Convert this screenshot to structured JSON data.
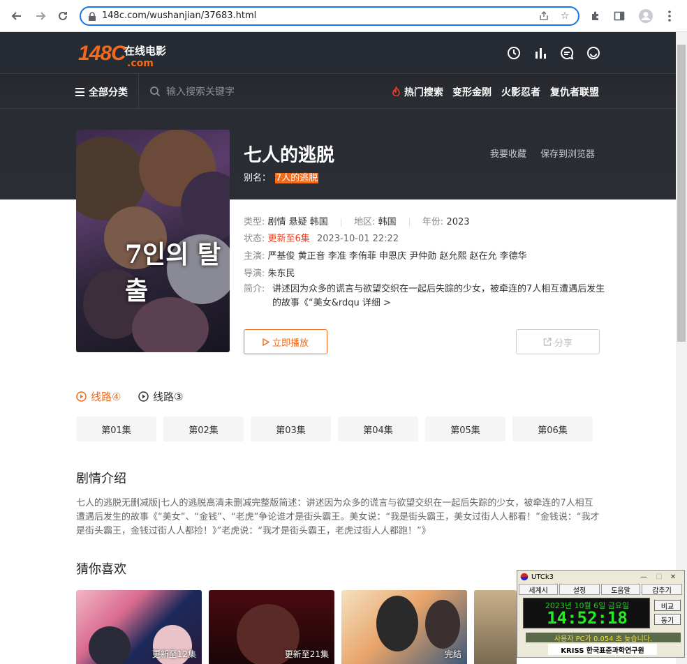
{
  "browser": {
    "url": "148c.com/wushanjian/37683.html"
  },
  "site": {
    "logo_main": "148C",
    "logo_sub": "在线电影",
    "logo_domain": ".com",
    "all_categories": "全部分类",
    "search_placeholder": "输入搜索关键字",
    "hot_search": "热门搜索",
    "hot_links": [
      "变形金刚",
      "火影忍者",
      "复仇者联盟"
    ]
  },
  "movie": {
    "title": "七人的逃脱",
    "alias_label": "别名：",
    "alias_value": "7人的逃脱",
    "favorite": "我要收藏",
    "save_browser": "保存到浏览器",
    "type_label": "类型:",
    "type_value": "剧情 悬疑 韩国",
    "region_label": "地区:",
    "region_value": "韩国",
    "year_label": "年份:",
    "year_value": "2023",
    "status_label": "状态:",
    "status_value": "更新至6集",
    "status_time": "2023-10-01 22:22",
    "cast_label": "主演:",
    "cast_value": "严基俊 黄正音 李准 李侑菲 申恩庆 尹仲勋 赵允熙 赵在允 李德华",
    "director_label": "导演:",
    "director_value": "朱东民",
    "synopsis_label": "简介:",
    "synopsis_value": "讲述因为众多的谎言与欲望交织在一起后失踪的少女，被牵连的7人相互遭遇后发生的故事《“美女&rdqu 详细 >",
    "play_label": "立即播放",
    "share_label": "分享",
    "poster_text": "7인의 탈출"
  },
  "routes": [
    "线路④",
    "线路③"
  ],
  "episodes": [
    "第01集",
    "第02集",
    "第03集",
    "第04集",
    "第05集",
    "第06集"
  ],
  "plot": {
    "title": "剧情介绍",
    "text": "七人的逃脱无删减版|七人的逃脱高清未删减完整版简述：讲述因为众多的谎言与欲望交织在一起后失踪的少女，被牵连的7人相互遭遇后发生的故事《“美女”、“金钱”、“老虎”争论谁才是街头霸王。美女说：“我是街头霸王，美女过街人人都看！”金钱说：“我才是街头霸王，金钱过街人人都捡！》”老虎说：“我才是街头霸王，老虎过街人人都跑！”》"
  },
  "recommend": {
    "title": "猜你喜欢",
    "cards": [
      {
        "badge": "更新至12集"
      },
      {
        "badge": "更新至21集"
      },
      {
        "badge": "完结"
      },
      {
        "badge": ""
      }
    ]
  },
  "utck3": {
    "title": "UTCk3",
    "menu": [
      "세계시",
      "설정",
      "도움말",
      "감추기"
    ],
    "date": "2023년 10월 6일 금요일",
    "time": "14:52:18",
    "btn_compare": "비교",
    "btn_sync": "동기",
    "status": "사용자 PC가 0.054 초 늦습니다.",
    "brand": "KRISS 한국표준과학연구원"
  },
  "colors": {
    "accent": "#f26a1b",
    "header_bg": "#262a33",
    "status_red": "#f23c1b"
  }
}
